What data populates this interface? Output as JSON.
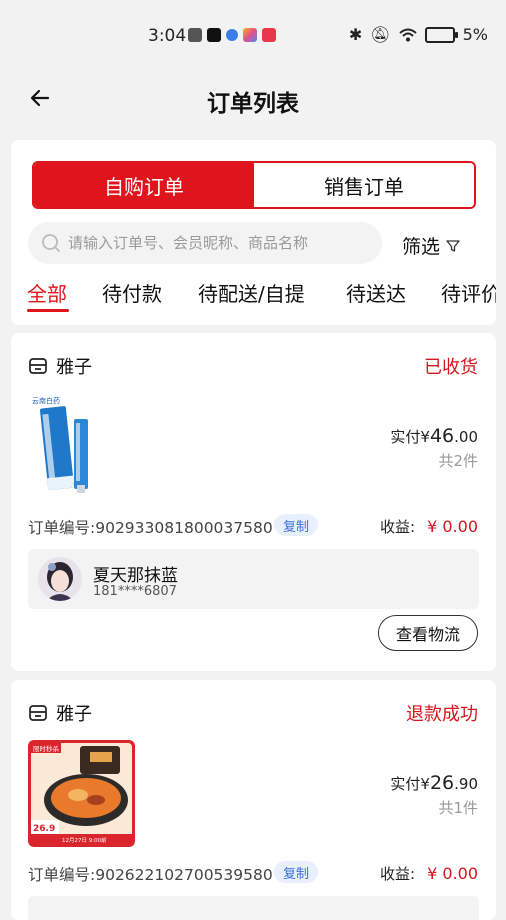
{
  "status_bar": {
    "time": "3:04",
    "battery": "5%"
  },
  "header": {
    "title": "订单列表"
  },
  "segments": [
    {
      "label": "自购订单"
    },
    {
      "label": "销售订单"
    }
  ],
  "search": {
    "placeholder": "请输入订单号、会员昵称、商品名称",
    "filter_label": "筛选"
  },
  "tabs": [
    {
      "label": "全部"
    },
    {
      "label": "待付款"
    },
    {
      "label": "待配送/自提"
    },
    {
      "label": "待送达"
    },
    {
      "label": "待评价"
    }
  ],
  "orders": [
    {
      "shop": "雅子",
      "status": "已收货",
      "pay_prefix": "实付¥",
      "pay_int": "46",
      "pay_dec": ".00",
      "count": "共2件",
      "order_no": "订单编号:902933081800037580",
      "copy_label": "复制",
      "earn_label": "收益:",
      "earn_amount": "¥ 0.00",
      "member": {
        "name": "夏天那抹蓝",
        "phone": "181****6807"
      },
      "action_label": "查看物流"
    },
    {
      "shop": "雅子",
      "status": "退款成功",
      "pay_prefix": "实付¥",
      "pay_int": "26",
      "pay_dec": ".90",
      "count": "共1件",
      "order_no": "订单编号:902622102700539580",
      "copy_label": "复制",
      "earn_label": "收益:",
      "earn_amount": "¥ 0.00",
      "thumb_text": {
        "badge": "限时秒杀",
        "price": "26.9",
        "date": "12月27日 9:00前"
      }
    }
  ],
  "colors": {
    "accent": "#e0141d",
    "status_red": "#d4161d",
    "copy_blue": "#3b6fd8"
  }
}
